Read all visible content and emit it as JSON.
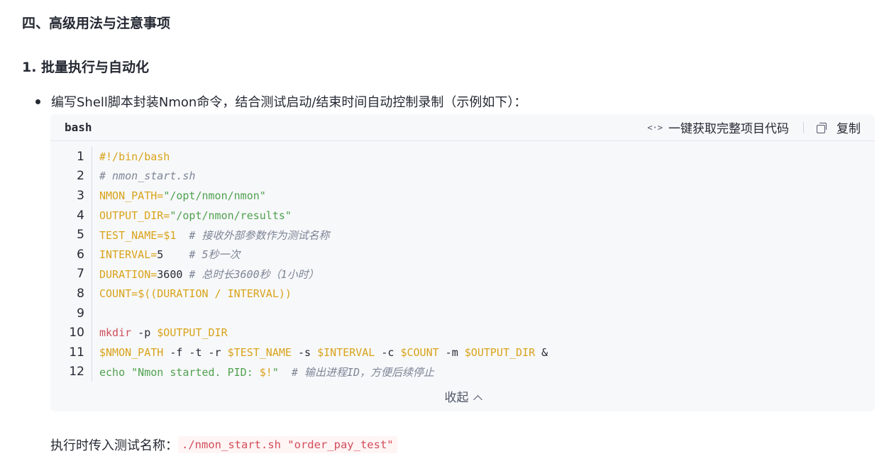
{
  "section_title": "四、高级用法与注意事项",
  "subsection_title": "1. 批量执行与自动化",
  "bullet_text": "编写Shell脚本封装Nmon命令，结合测试启动/结束时间自动控制录制（示例如下）：",
  "code_block": {
    "language": "bash",
    "get_code_label": "一键获取完整项目代码",
    "get_code_icon": "code-brackets-icon",
    "copy_label": "复制",
    "copy_icon": "copy-icon",
    "collapse_label": "收起",
    "lines": [
      {
        "num": "1",
        "tokens": [
          {
            "t": "#!/bin/bash",
            "c": "y"
          }
        ]
      },
      {
        "num": "2",
        "tokens": [
          {
            "t": "# nmon_start.sh",
            "c": "cm"
          }
        ]
      },
      {
        "num": "3",
        "tokens": [
          {
            "t": "NMON_PATH=",
            "c": "y"
          },
          {
            "t": "\"/opt/nmon/nmon\"",
            "c": "g"
          }
        ]
      },
      {
        "num": "4",
        "tokens": [
          {
            "t": "OUTPUT_DIR=",
            "c": "y"
          },
          {
            "t": "\"/opt/nmon/results\"",
            "c": "g"
          }
        ]
      },
      {
        "num": "5",
        "tokens": [
          {
            "t": "TEST_NAME=",
            "c": "y"
          },
          {
            "t": "$1",
            "c": "y"
          },
          {
            "t": "  # 接收外部参数作为测试名称",
            "c": "cm"
          }
        ]
      },
      {
        "num": "6",
        "tokens": [
          {
            "t": "INTERVAL=",
            "c": "y"
          },
          {
            "t": "5",
            "c": "k"
          },
          {
            "t": "    # 5秒一次",
            "c": "cm"
          }
        ]
      },
      {
        "num": "7",
        "tokens": [
          {
            "t": "DURATION=",
            "c": "y"
          },
          {
            "t": "3600",
            "c": "k"
          },
          {
            "t": " # 总时长3600秒（1小时）",
            "c": "cm"
          }
        ]
      },
      {
        "num": "8",
        "tokens": [
          {
            "t": "COUNT=",
            "c": "y"
          },
          {
            "t": "$((DURATION / INTERVAL))",
            "c": "y"
          }
        ]
      },
      {
        "num": "9",
        "tokens": []
      },
      {
        "num": "10",
        "tokens": [
          {
            "t": "mkdir",
            "c": "r"
          },
          {
            "t": " -p ",
            "c": "k"
          },
          {
            "t": "$OUTPUT_DIR",
            "c": "y"
          }
        ]
      },
      {
        "num": "11",
        "tokens": [
          {
            "t": "$NMON_PATH",
            "c": "y"
          },
          {
            "t": " -f -t -r ",
            "c": "k"
          },
          {
            "t": "$TEST_NAME",
            "c": "y"
          },
          {
            "t": " -s ",
            "c": "k"
          },
          {
            "t": "$INTERVAL",
            "c": "y"
          },
          {
            "t": " -c ",
            "c": "k"
          },
          {
            "t": "$COUNT",
            "c": "y"
          },
          {
            "t": " -m ",
            "c": "k"
          },
          {
            "t": "$OUTPUT_DIR",
            "c": "y"
          },
          {
            "t": " &",
            "c": "k"
          }
        ]
      },
      {
        "num": "12",
        "tokens": [
          {
            "t": "echo",
            "c": "g"
          },
          {
            "t": " \"Nmon started. PID: ",
            "c": "g"
          },
          {
            "t": "$!",
            "c": "y"
          },
          {
            "t": "\"",
            "c": "g"
          },
          {
            "t": "  # 输出进程ID，方便后续停止",
            "c": "cm"
          }
        ]
      }
    ]
  },
  "exec_text": "执行时传入测试名称：",
  "exec_command": "./nmon_start.sh \"order_pay_test\""
}
